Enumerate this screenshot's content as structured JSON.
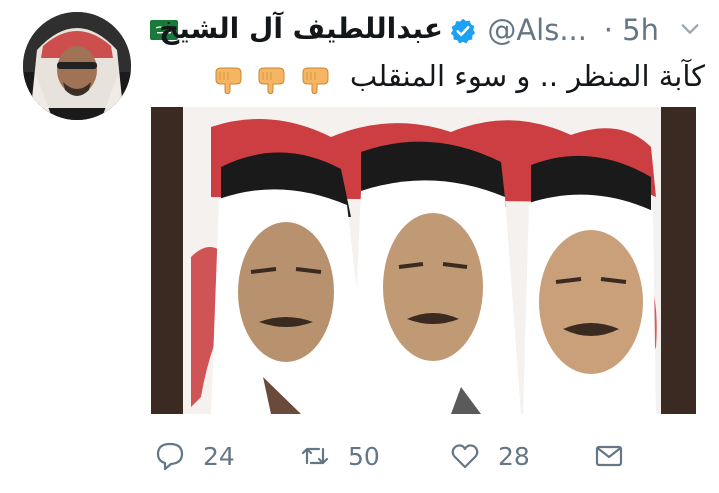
{
  "author": {
    "display_name": "عبداللطيف آل الشيخ",
    "handle": "@Als...",
    "separator": "·",
    "time": "5h",
    "verified": true,
    "flag": "saudi-flag"
  },
  "tweet": {
    "text": "كآبة المنظر .. و سوء المنقلب",
    "emoji": [
      "backhand-index-pointing-down",
      "backhand-index-pointing-down",
      "backhand-index-pointing-down"
    ]
  },
  "actions": {
    "reply_count": "24",
    "retweet_count": "50",
    "like_count": "28"
  },
  "colors": {
    "text_primary": "#14171a",
    "text_secondary": "#657786",
    "verified_blue": "#1da1f2",
    "flag_green": "#1a7a3a",
    "painting_red": "#c41e22"
  }
}
